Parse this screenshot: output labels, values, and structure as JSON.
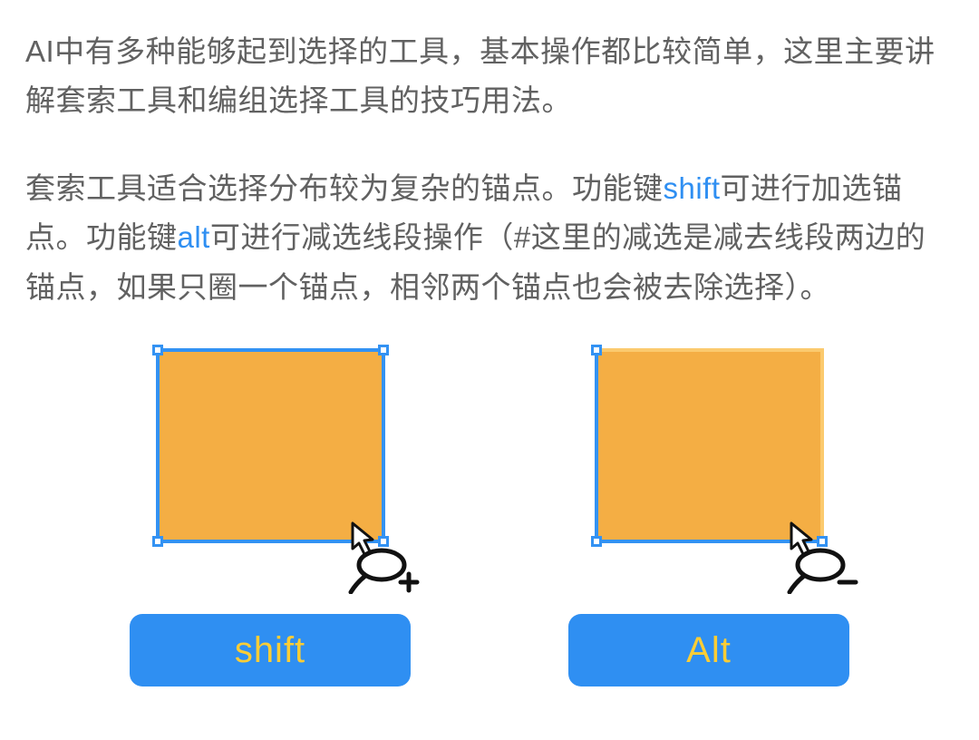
{
  "paragraph1": "AI中有多种能够起到选择的工具，基本操作都比较简单，这里主要讲解套索工具和编组选择工具的技巧用法。",
  "paragraph2": {
    "seg1": "套索工具适合选择分布较为复杂的锚点。功能键",
    "kw1": "shift",
    "seg2": "可进行加选锚点。功能键",
    "kw2": "alt",
    "seg3": "可进行减选线段操作（#这里的减选是减去线段两边的锚点，如果只圈一个锚点，相邻两个锚点也会被去除选择）。"
  },
  "keys": {
    "shift_label": "shift",
    "alt_label": "Alt"
  }
}
